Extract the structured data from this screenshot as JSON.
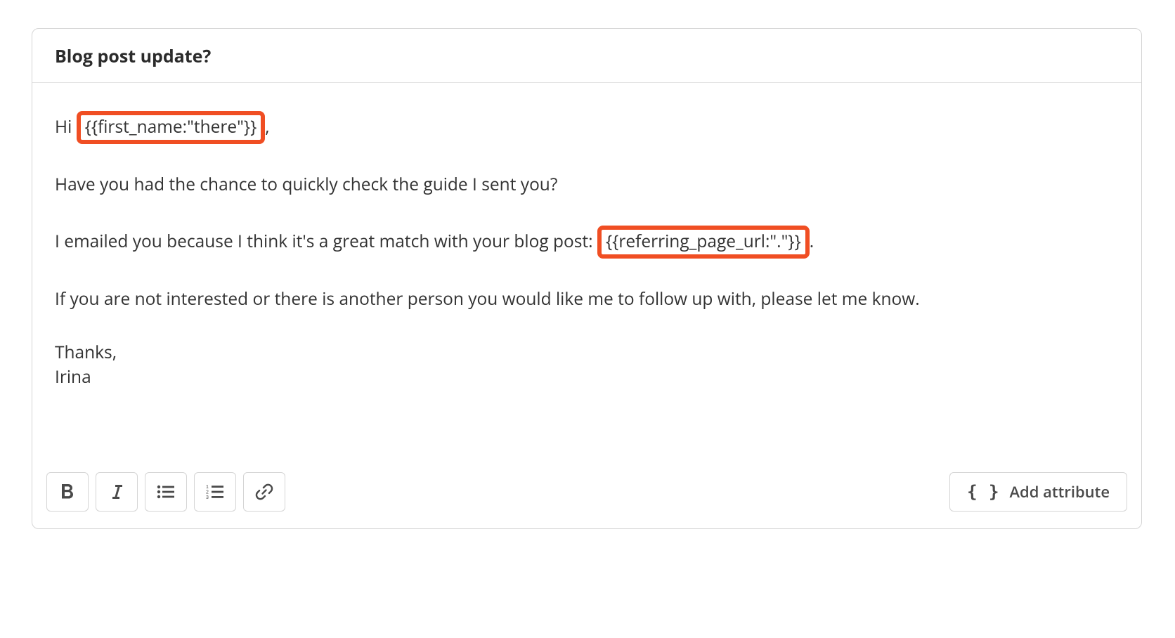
{
  "subject": "Blog post update?",
  "body": {
    "greeting_prefix": "Hi ",
    "greeting_token": "{{first_name:\"there\"}}",
    "greeting_suffix": ",",
    "line1": "Have you had the chance to quickly check the guide I sent you?",
    "line2_prefix": "I emailed you because I think it's a great match with your blog post: ",
    "line2_token": "{{referring_page_url:\".\"}}",
    "line2_suffix": ".",
    "line3": "If you are not interested or there is another person you would like me to follow up with, please let me know.",
    "signoff": "Thanks,",
    "signature": "Irina"
  },
  "toolbar": {
    "add_attribute_label": "Add attribute"
  }
}
